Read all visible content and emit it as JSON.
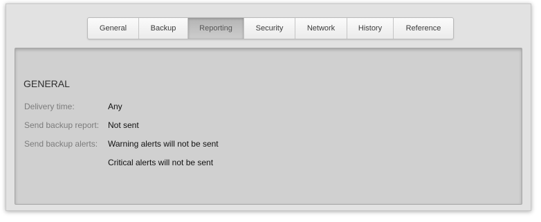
{
  "tabs": [
    {
      "label": "General",
      "active": false
    },
    {
      "label": "Backup",
      "active": false
    },
    {
      "label": "Reporting",
      "active": true
    },
    {
      "label": "Security",
      "active": false
    },
    {
      "label": "Network",
      "active": false
    },
    {
      "label": "History",
      "active": false
    },
    {
      "label": "Reference",
      "active": false
    }
  ],
  "section": {
    "title": "GENERAL",
    "delivery_time": {
      "label": "Delivery time:",
      "value": "Any"
    },
    "backup_report": {
      "label": "Send backup report:",
      "value": "Not sent"
    },
    "backup_alerts": {
      "label": "Send backup alerts:",
      "values": [
        "Warning alerts will not be sent",
        "Critical alerts will not be sent"
      ]
    }
  },
  "colors": {
    "window_bg": "#e2e2e2",
    "panel_bg": "#d0d0d0",
    "active_tab_bg": "#bdbdbd",
    "label_text": "#7c7c7c",
    "value_text": "#111111"
  }
}
